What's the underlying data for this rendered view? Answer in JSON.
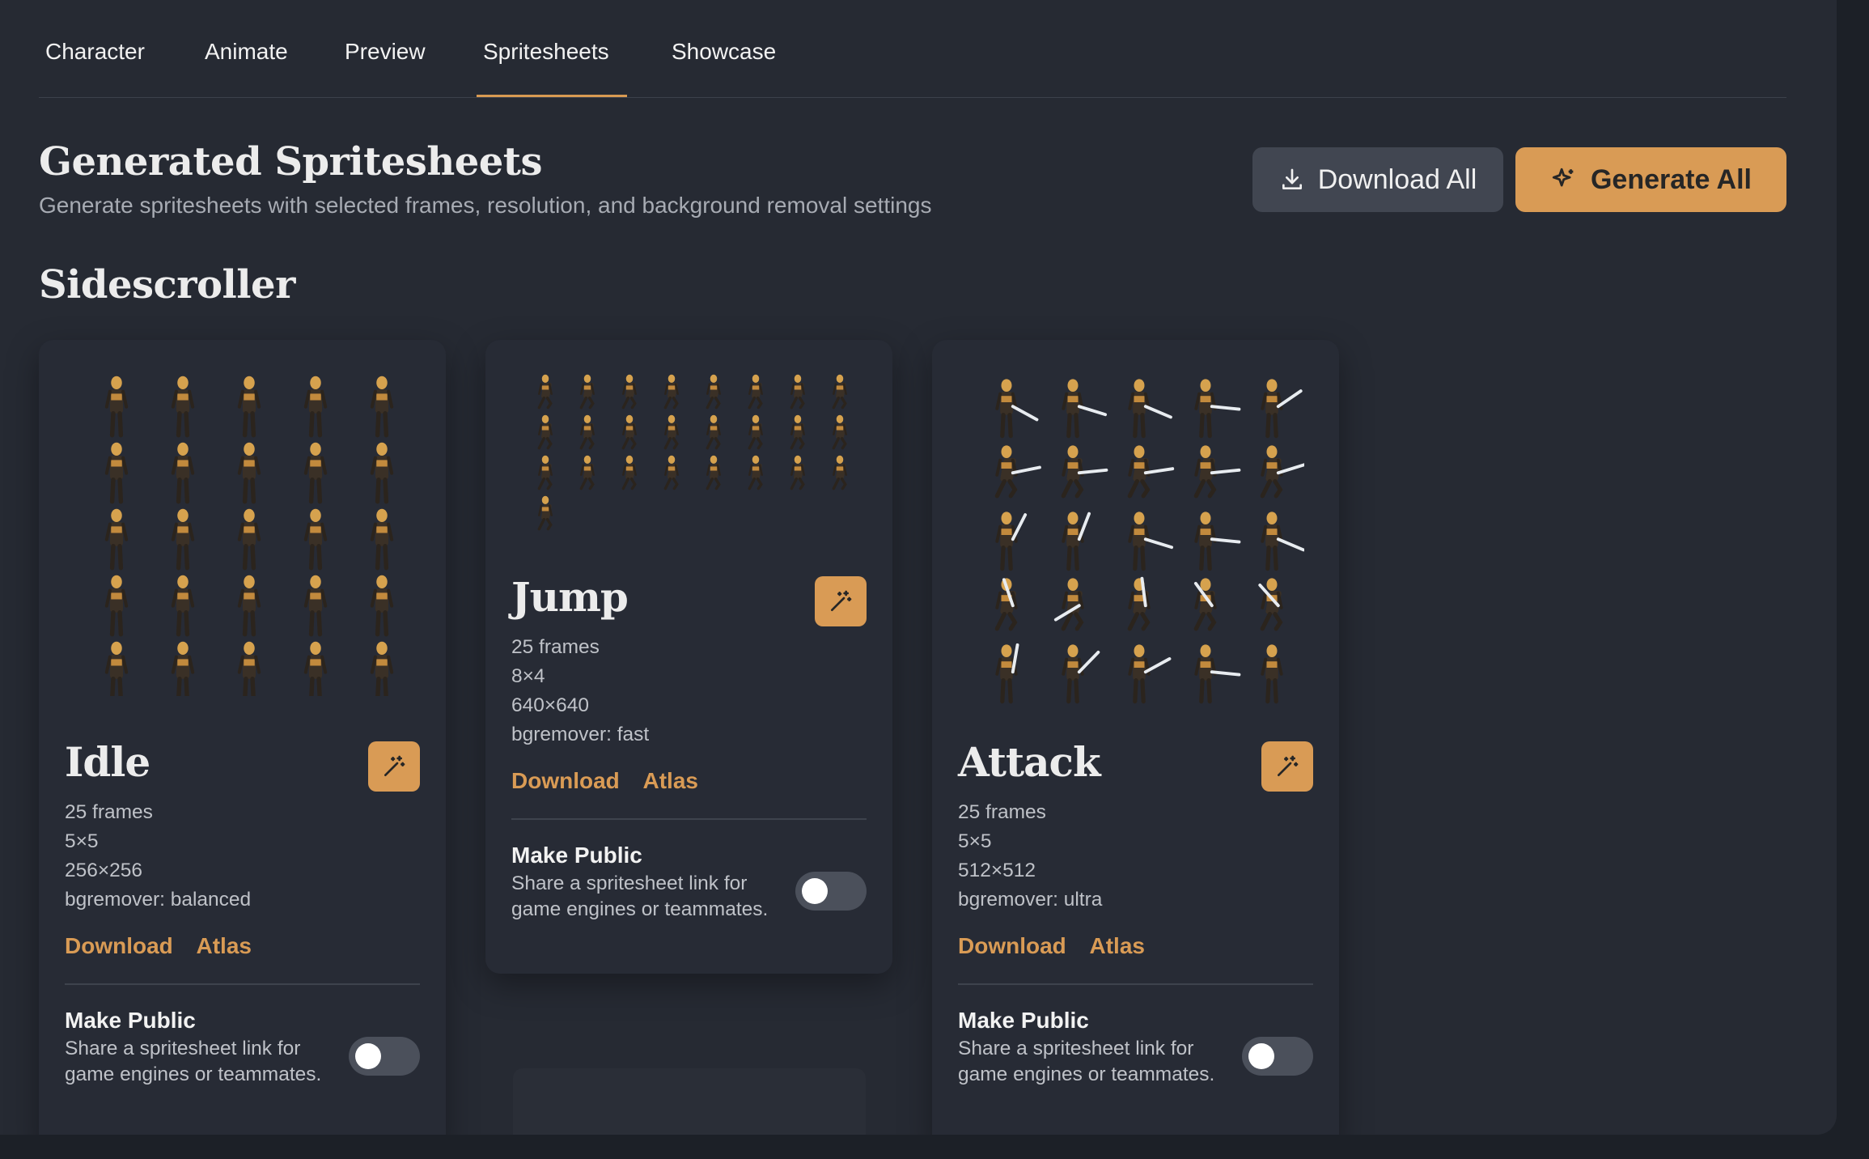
{
  "tabs": [
    {
      "label": "Character"
    },
    {
      "label": "Animate"
    },
    {
      "label": "Preview"
    },
    {
      "label": "Spritesheets",
      "active": true
    },
    {
      "label": "Showcase"
    }
  ],
  "header": {
    "title": "Generated Spritesheets",
    "subtitle": "Generate spritesheets with selected frames, resolution, and background removal settings",
    "download_all_label": "Download All",
    "generate_all_label": "Generate All"
  },
  "section": {
    "title": "Sidescroller"
  },
  "cards": [
    {
      "title": "Idle",
      "frames": "25 frames",
      "grid": "5×5",
      "resolution": "256×256",
      "bgremover": "bgremover: balanced",
      "download_label": "Download",
      "atlas_label": "Atlas",
      "public_title": "Make Public",
      "public_desc": "Share a spritesheet link for game engines or teammates.",
      "is_public": false
    },
    {
      "title": "Jump",
      "frames": "25 frames",
      "grid": "8×4",
      "resolution": "640×640",
      "bgremover": "bgremover: fast",
      "download_label": "Download",
      "atlas_label": "Atlas",
      "public_title": "Make Public",
      "public_desc": "Share a spritesheet link for game engines or teammates.",
      "is_public": false
    },
    {
      "title": "Attack",
      "frames": "25 frames",
      "grid": "5×5",
      "resolution": "512×512",
      "bgremover": "bgremover: ultra",
      "download_label": "Download",
      "atlas_label": "Atlas",
      "public_title": "Make Public",
      "public_desc": "Share a spritesheet link for game engines or teammates.",
      "is_public": false
    }
  ],
  "colors": {
    "accent": "#d99b55",
    "background": "#262a33",
    "card": "#272b35"
  },
  "icons": {
    "download": "download-icon",
    "generate": "sparkle-icon",
    "wand": "magic-wand-icon"
  }
}
